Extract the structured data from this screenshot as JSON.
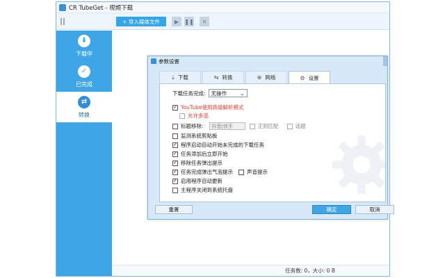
{
  "window": {
    "title": "CR TubeGet - 视频下载"
  },
  "toolbar": {
    "import_label": "+ 导入媒体文件"
  },
  "sidebar": {
    "items": [
      {
        "label": "下载中",
        "icon": "download-icon"
      },
      {
        "label": "已完成",
        "icon": "check-icon"
      },
      {
        "label": "转换",
        "icon": "convert-icon",
        "active": true
      }
    ]
  },
  "status": {
    "text": "任务数: 0，大小: 0 B"
  },
  "dialog": {
    "title": "参数设置",
    "tabs": [
      {
        "label": "下载",
        "icon": "download-icon"
      },
      {
        "label": "转换",
        "icon": "convert-icon"
      },
      {
        "label": "网络",
        "icon": "network-icon"
      },
      {
        "label": "设置",
        "icon": "gear-icon",
        "active": true
      }
    ],
    "on_complete_label": "下载任务完成:",
    "on_complete_value": "无操作",
    "youtube_label": "YouTube使用高级解析模式",
    "youtube_checked": true,
    "allow_multi_label": "允许多选",
    "allow_multi_checked": false,
    "title_remove_label": "标题移除:",
    "title_remove_placeholder": "抖音|快手",
    "title_remove_checked": false,
    "regex_label": "正则匹配",
    "regex_checked": false,
    "topic_label": "话题",
    "topic_checked": false,
    "options": [
      {
        "label": "监测系统剪贴板",
        "checked": false
      },
      {
        "label": "程序启动自动开始未完成的下载任务",
        "checked": true
      },
      {
        "label": "任务添加后立即开始",
        "checked": true
      },
      {
        "label": "移除任务弹出提示",
        "checked": true
      },
      {
        "label": "任务完成弹出气泡提示",
        "checked": true
      },
      {
        "label": "启用程序自动更新",
        "checked": true
      },
      {
        "label": "主程序关闭到系统托盘",
        "checked": false
      }
    ],
    "sound_label": "声音提示",
    "sound_checked": false,
    "reset_label": "重置",
    "ok_label": "确定",
    "cancel_label": "取消"
  }
}
